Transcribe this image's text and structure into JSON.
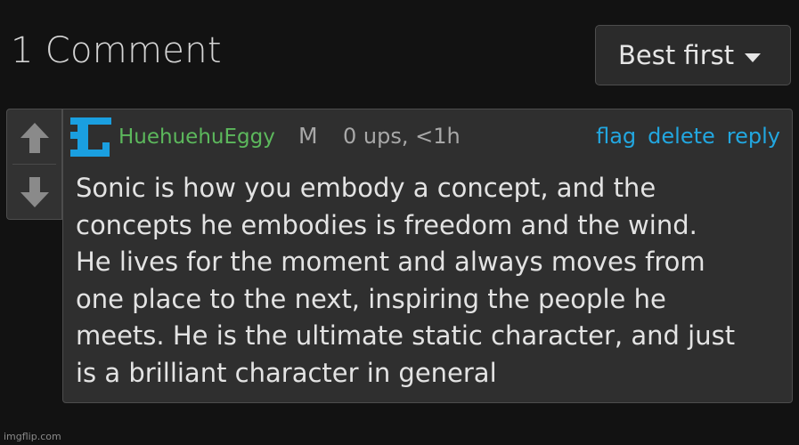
{
  "header": {
    "title": "1 Comment",
    "sort_label": "Best first"
  },
  "comment": {
    "username": "HuehuehuEggy",
    "badge": "M",
    "meta": "0 ups, <1h",
    "actions": {
      "flag": "flag",
      "delete": "delete",
      "reply": "reply"
    },
    "text": "Sonic is how you embody a concept, and the\nconcepts he embodies is freedom and the wind.\nHe lives for the moment and always moves from\none place to the next, inspiring the people he\nmeets. He is the ultimate static character, and just\nis a brilliant character in general"
  },
  "icons": {
    "upvote": "arrow-up-icon",
    "downvote": "arrow-down-icon",
    "avatar": "avatar-icon",
    "sort_caret": "caret-down-icon"
  },
  "colors": {
    "username": "#5cb85c",
    "link": "#22a7e0",
    "avatar": "#1a9fe0",
    "background": "#121212",
    "panel": "#2f2f2f"
  },
  "watermark": "imgflip.com"
}
